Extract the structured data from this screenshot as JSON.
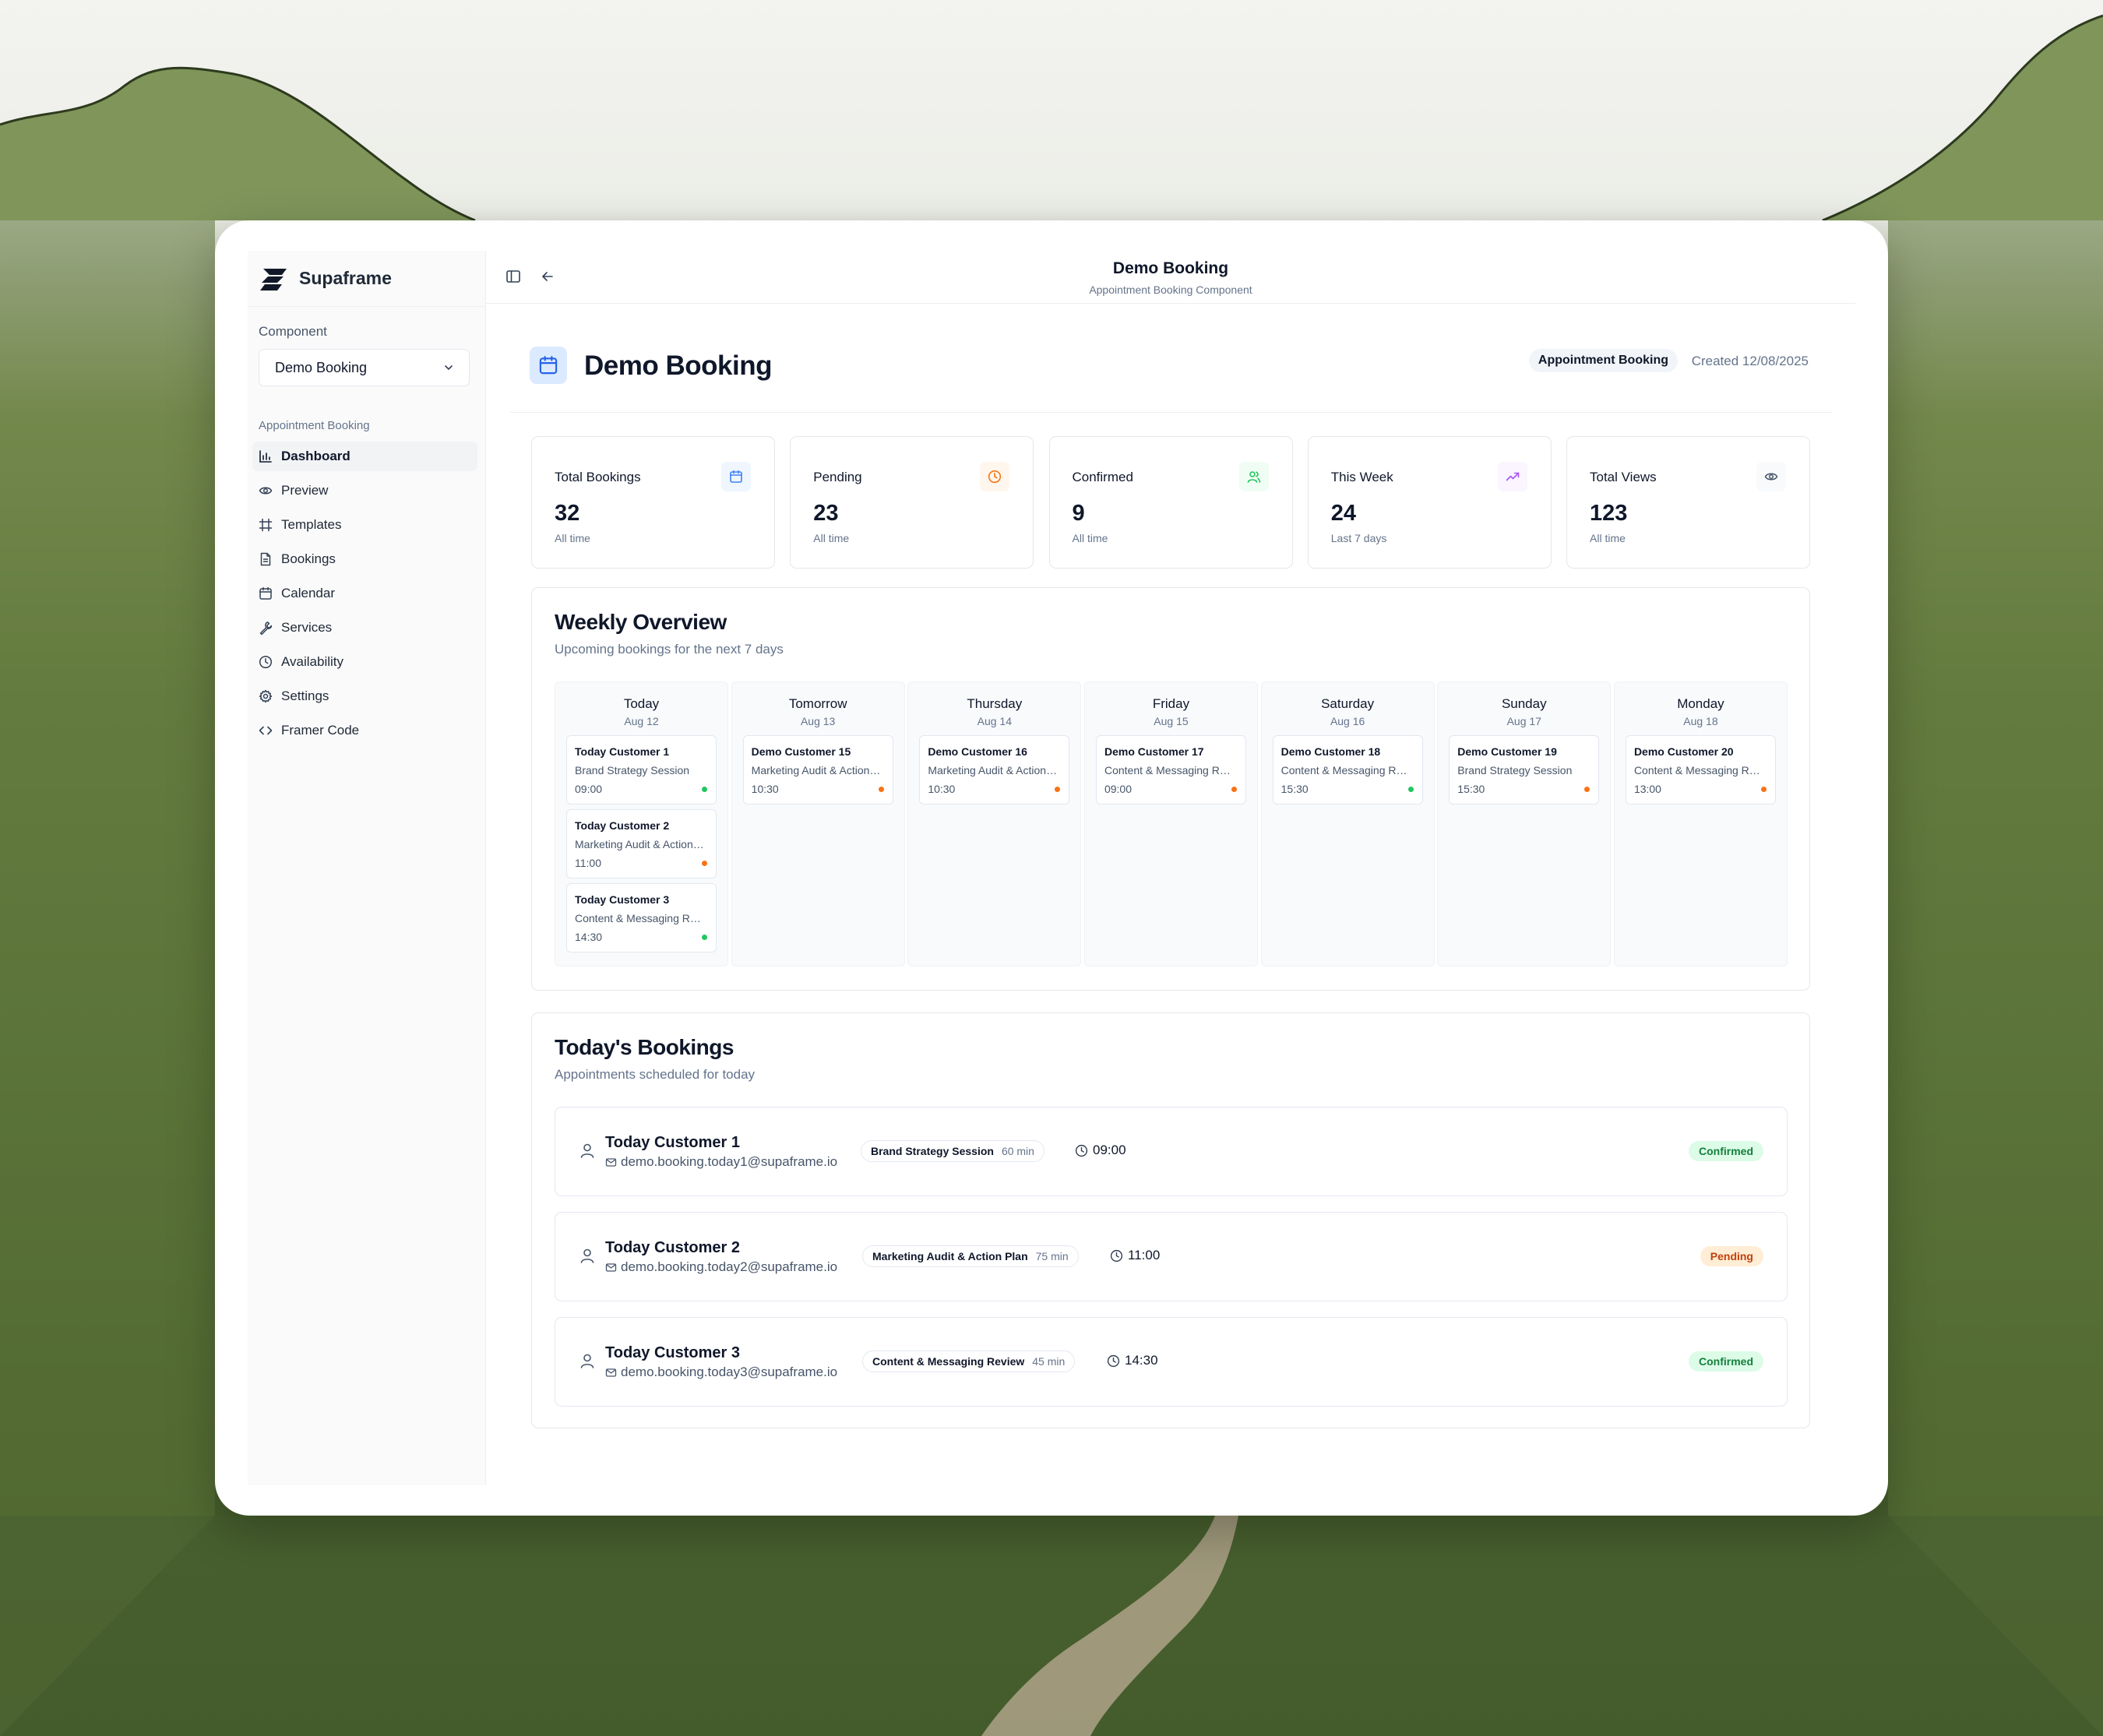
{
  "brand": {
    "name": "Supaframe"
  },
  "sidebar": {
    "component_label": "Component",
    "component_value": "Demo Booking",
    "group_label": "Appointment Booking",
    "items": [
      {
        "label": "Dashboard",
        "icon": "bar-chart-icon",
        "active": true
      },
      {
        "label": "Preview",
        "icon": "eye-icon"
      },
      {
        "label": "Templates",
        "icon": "frame-icon"
      },
      {
        "label": "Bookings",
        "icon": "file-text-icon"
      },
      {
        "label": "Calendar",
        "icon": "calendar-icon"
      },
      {
        "label": "Services",
        "icon": "wrench-icon"
      },
      {
        "label": "Availability",
        "icon": "clock-icon"
      },
      {
        "label": "Settings",
        "icon": "gear-icon"
      },
      {
        "label": "Framer Code",
        "icon": "code-icon"
      }
    ]
  },
  "topbar": {
    "title": "Demo Booking",
    "subtitle": "Appointment Booking Component"
  },
  "page": {
    "title": "Demo Booking",
    "badge": "Appointment Booking",
    "created": "Created 12/08/2025"
  },
  "stats": [
    {
      "label": "Total Bookings",
      "value": "32",
      "sub": "All time",
      "icon": "calendar-icon",
      "color": "#3b82f6",
      "bg": "#eff6ff"
    },
    {
      "label": "Pending",
      "value": "23",
      "sub": "All time",
      "icon": "clock-icon",
      "color": "#f97316",
      "bg": "#fff7ed"
    },
    {
      "label": "Confirmed",
      "value": "9",
      "sub": "All time",
      "icon": "users-icon",
      "color": "#22c55e",
      "bg": "#f0fdf4"
    },
    {
      "label": "This Week",
      "value": "24",
      "sub": "Last 7 days",
      "icon": "trending-up-icon",
      "color": "#a855f7",
      "bg": "#faf5ff"
    },
    {
      "label": "Total Views",
      "value": "123",
      "sub": "All time",
      "icon": "eye-icon",
      "color": "#475569",
      "bg": "#f8fafc"
    }
  ],
  "weekly": {
    "title": "Weekly Overview",
    "subtitle": "Upcoming bookings for the next 7 days",
    "days": [
      {
        "name": "Today",
        "date": "Aug 12",
        "bookings": [
          {
            "name": "Today Customer 1",
            "service": "Brand Strategy Session",
            "time": "09:00",
            "status": "confirmed"
          },
          {
            "name": "Today Customer 2",
            "service": "Marketing Audit & Action Plan",
            "time": "11:00",
            "status": "pending"
          },
          {
            "name": "Today Customer 3",
            "service": "Content & Messaging Review",
            "time": "14:30",
            "status": "confirmed"
          }
        ]
      },
      {
        "name": "Tomorrow",
        "date": "Aug 13",
        "bookings": [
          {
            "name": "Demo Customer 15",
            "service": "Marketing Audit & Action Plan",
            "time": "10:30",
            "status": "pending"
          }
        ]
      },
      {
        "name": "Thursday",
        "date": "Aug 14",
        "bookings": [
          {
            "name": "Demo Customer 16",
            "service": "Marketing Audit & Action Plan",
            "time": "10:30",
            "status": "pending"
          }
        ]
      },
      {
        "name": "Friday",
        "date": "Aug 15",
        "bookings": [
          {
            "name": "Demo Customer 17",
            "service": "Content & Messaging Review",
            "time": "09:00",
            "status": "pending"
          }
        ]
      },
      {
        "name": "Saturday",
        "date": "Aug 16",
        "bookings": [
          {
            "name": "Demo Customer 18",
            "service": "Content & Messaging Review",
            "time": "15:30",
            "status": "confirmed"
          }
        ]
      },
      {
        "name": "Sunday",
        "date": "Aug 17",
        "bookings": [
          {
            "name": "Demo Customer 19",
            "service": "Brand Strategy Session",
            "time": "15:30",
            "status": "pending"
          }
        ]
      },
      {
        "name": "Monday",
        "date": "Aug 18",
        "bookings": [
          {
            "name": "Demo Customer 20",
            "service": "Content & Messaging Review",
            "time": "13:00",
            "status": "pending"
          }
        ]
      }
    ]
  },
  "today": {
    "title": "Today's Bookings",
    "subtitle": "Appointments scheduled for today",
    "rows": [
      {
        "name": "Today Customer 1",
        "email": "demo.booking.today1@supaframe.io",
        "service": "Brand Strategy Session",
        "duration": "60 min",
        "time": "09:00",
        "status": "Confirmed"
      },
      {
        "name": "Today Customer 2",
        "email": "demo.booking.today2@supaframe.io",
        "service": "Marketing Audit & Action Plan",
        "duration": "75 min",
        "time": "11:00",
        "status": "Pending"
      },
      {
        "name": "Today Customer 3",
        "email": "demo.booking.today3@supaframe.io",
        "service": "Content & Messaging Review",
        "duration": "45 min",
        "time": "14:30",
        "status": "Confirmed"
      }
    ]
  },
  "colors": {
    "confirmed_dot": "#22c55e",
    "pending_dot": "#f97316"
  }
}
